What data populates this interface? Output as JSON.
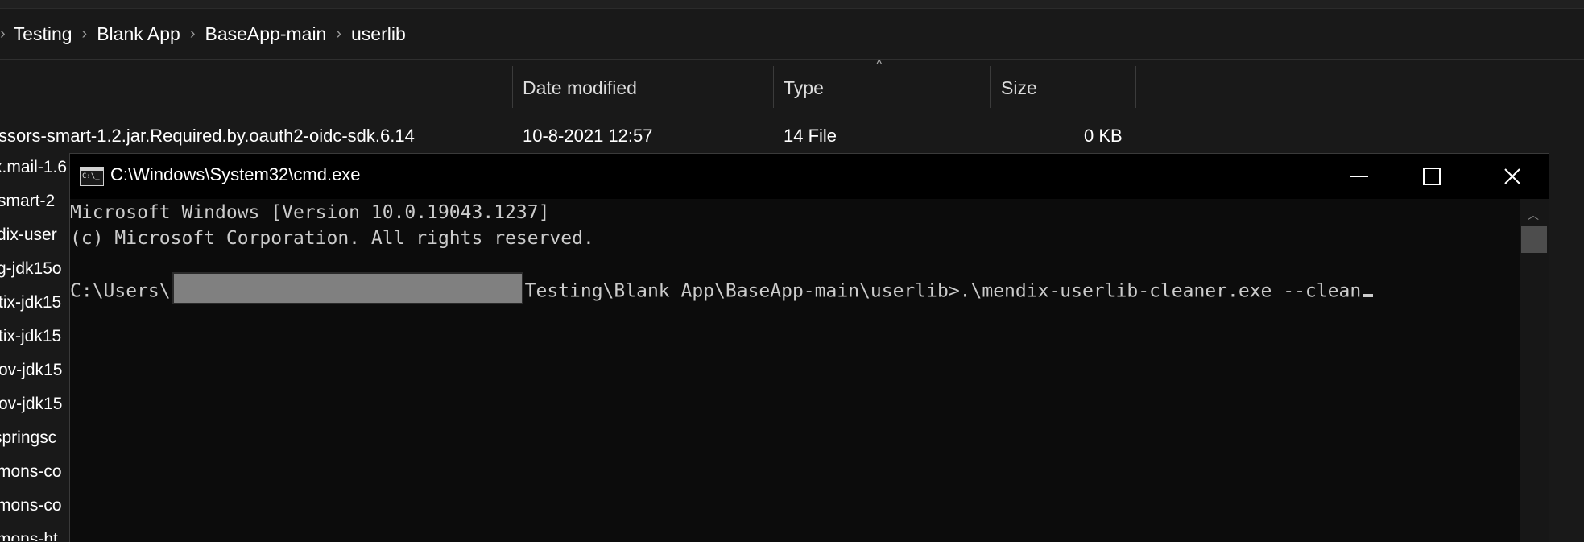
{
  "explorer": {
    "breadcrumb": [
      "Testing",
      "Blank App",
      "BaseApp-main",
      "userlib"
    ],
    "columns": {
      "date_modified": "Date modified",
      "type": "Type",
      "size": "Size"
    },
    "first_row": {
      "name": "ssors-smart-1.2.jar.Required.by.oauth2-oidc-sdk.6.14",
      "date_modified": "10-8-2021 12:57",
      "type": "14 File",
      "size": "0 KB"
    },
    "partial_names": [
      "x.mail-1.6",
      "-smart-2",
      "dix-user",
      "g-jdk15o",
      "tix-jdk15",
      "tix-jdk15",
      "ov-jdk15",
      "ov-jdk15",
      "springsc",
      "mons-co",
      "mons-co",
      "mons-ht"
    ]
  },
  "cmd": {
    "title": "C:\\Windows\\System32\\cmd.exe",
    "icon_text": "C:\\_",
    "lines": {
      "version": "Microsoft Windows [Version 10.0.19043.1237]",
      "copyright": "(c) Microsoft Corporation. All rights reserved.",
      "prompt_prefix": "C:\\Users\\",
      "prompt_suffix": "Testing\\Blank App\\BaseApp-main\\userlib>.\\mendix-userlib-cleaner.exe --clean"
    },
    "minimize_icon": "minimize-icon",
    "maximize_icon": "maximize-icon",
    "close_icon": "close-icon"
  }
}
